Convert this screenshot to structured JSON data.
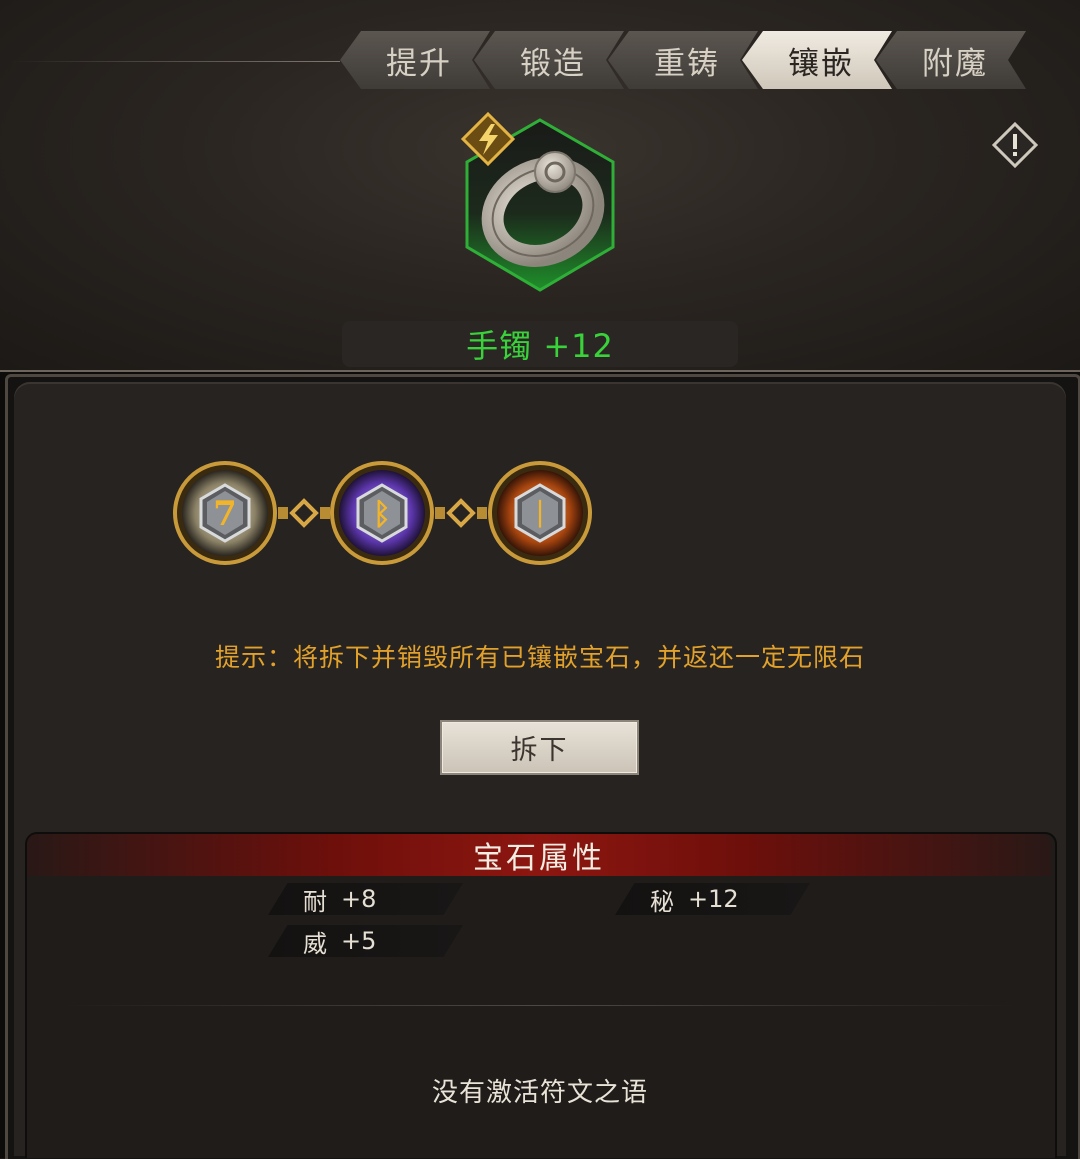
{
  "tabs": [
    {
      "label": "提升",
      "active": false
    },
    {
      "label": "锻造",
      "active": false
    },
    {
      "label": "重铸",
      "active": false
    },
    {
      "label": "镶嵌",
      "active": true
    },
    {
      "label": "附魔",
      "active": false
    }
  ],
  "item": {
    "name": "手镯 +12",
    "icon": "silver-ring-icon",
    "quality_color": "#1f8f2a",
    "badge_icon": "lightning-badge-icon"
  },
  "gems": [
    {
      "rune": "7",
      "color": "silver",
      "icon": "gem-socket-silver-icon"
    },
    {
      "rune": "ᛒ",
      "color": "purple",
      "icon": "gem-socket-purple-icon"
    },
    {
      "rune": "ᛁ",
      "color": "orange",
      "icon": "gem-socket-orange-icon"
    }
  ],
  "tip": "提示：将拆下并销毁所有已镶嵌宝石，并返还一定无限石",
  "remove_button": "拆下",
  "attributes": {
    "title": "宝石属性",
    "stats": [
      {
        "key": "耐",
        "value": "+8"
      },
      {
        "key": "秘",
        "value": "+12"
      },
      {
        "key": "威",
        "value": "+5"
      }
    ]
  },
  "no_rune_text": "没有激活符文之语",
  "colors": {
    "accent_orange": "#e1a12a",
    "item_name_green": "#39d23b",
    "header_red": "#8d1610"
  }
}
